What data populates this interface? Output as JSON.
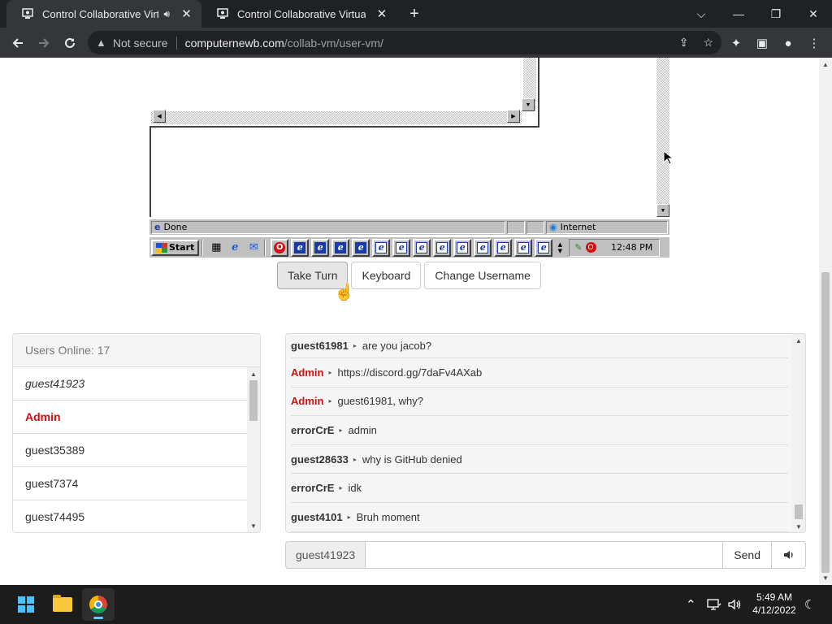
{
  "browser": {
    "tabs": [
      {
        "title": "Control Collaborative Virtual Machines",
        "active": true,
        "audio": true
      },
      {
        "title": "Control Collaborative Virtual Machines",
        "active": false,
        "audio": false
      }
    ],
    "address": {
      "security_label": "Not secure",
      "host": "computernewb.com",
      "path": "/collab-vm/user-vm/"
    }
  },
  "vm": {
    "status_text": "Done",
    "zone_text": "Internet",
    "start_label": "Start",
    "clock": "12:48 PM"
  },
  "controls": {
    "take_turn": "Take Turn",
    "keyboard": "Keyboard",
    "change_username": "Change Username"
  },
  "users": {
    "header": "Users Online: 17",
    "list": [
      {
        "name": "guest41923",
        "style": "me"
      },
      {
        "name": "Admin",
        "style": "admin"
      },
      {
        "name": "guest35389",
        "style": "normal"
      },
      {
        "name": "guest7374",
        "style": "normal"
      },
      {
        "name": "guest74495",
        "style": "normal"
      }
    ]
  },
  "chat": {
    "messages": [
      {
        "user": "guest61981",
        "text": "are you jacob?",
        "admin": false
      },
      {
        "user": "Admin",
        "text": "https://discord.gg/7daFv4AXab",
        "admin": true
      },
      {
        "user": "Admin",
        "text": "guest61981, why?",
        "admin": true
      },
      {
        "user": "errorCrE",
        "text": "admin",
        "admin": false
      },
      {
        "user": "guest28633",
        "text": "why is GitHub denied",
        "admin": false
      },
      {
        "user": "errorCrE",
        "text": "idk",
        "admin": false
      },
      {
        "user": "guest4101",
        "text": "Bruh moment",
        "admin": false
      }
    ],
    "input": {
      "username": "guest41923",
      "value": "",
      "send_label": "Send"
    }
  },
  "taskbar": {
    "time": "5:49 AM",
    "date": "4/12/2022"
  },
  "colors": {
    "admin": "#d01010",
    "chrome_dark": "#202124",
    "chrome_toolbar": "#35363a",
    "win98_gray": "#c0c0c0"
  }
}
